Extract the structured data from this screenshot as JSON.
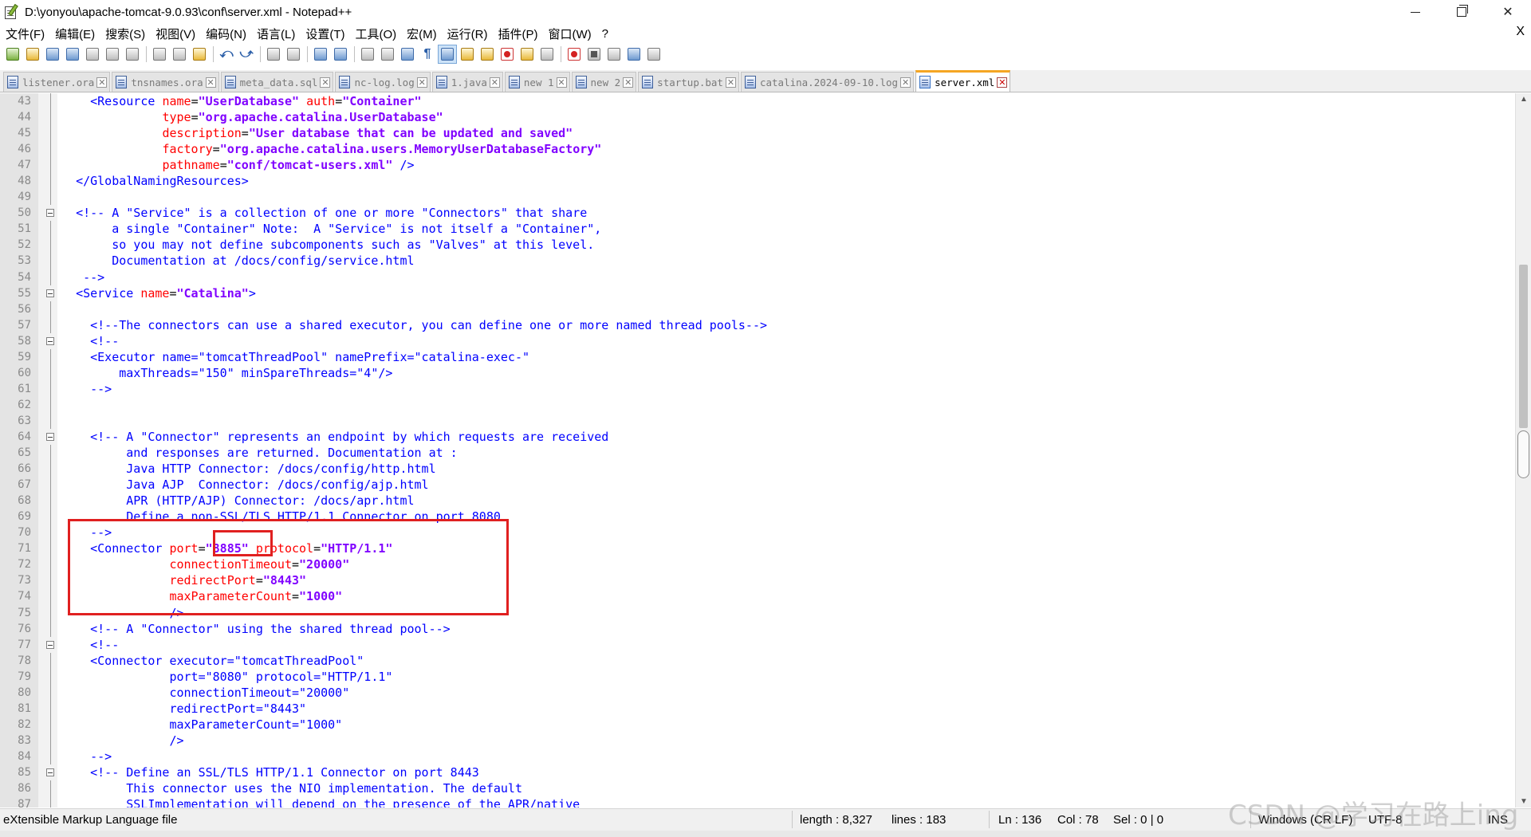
{
  "window": {
    "title": "D:\\yonyou\\apache-tomcat-9.0.93\\conf\\server.xml - Notepad++",
    "minimize": "",
    "restore": "",
    "close": "✕"
  },
  "menu": {
    "items": [
      "文件(F)",
      "编辑(E)",
      "搜索(S)",
      "视图(V)",
      "编码(N)",
      "语言(L)",
      "设置(T)",
      "工具(O)",
      "宏(M)",
      "运行(R)",
      "插件(P)",
      "窗口(W)",
      "?"
    ],
    "close": "X"
  },
  "toolbar": {
    "icons": [
      "new-file-icon",
      "open-file-icon",
      "save-icon",
      "save-all-icon",
      "close-icon",
      "close-all-icon",
      "print-icon",
      "cut-icon",
      "copy-icon",
      "paste-icon",
      "undo-icon",
      "redo-icon",
      "find-icon",
      "replace-icon",
      "zoom-in-icon",
      "zoom-out-icon",
      "sync-vertical-icon",
      "sync-horizontal-icon",
      "word-wrap-icon",
      "show-all-chars-icon",
      "indent-guide-icon",
      "user-language-icon",
      "doc-map-icon",
      "function-list-icon",
      "folder-workspace-icon",
      "monitoring-icon",
      "record-macro-icon",
      "stop-macro-icon",
      "play-macro-icon",
      "run-macro-multiple-icon",
      "save-macro-icon"
    ]
  },
  "tabs": [
    {
      "label": "listener.ora",
      "active": false
    },
    {
      "label": "tnsnames.ora",
      "active": false
    },
    {
      "label": "meta_data.sql",
      "active": false
    },
    {
      "label": "nc-log.log",
      "active": false
    },
    {
      "label": "1.java",
      "active": false
    },
    {
      "label": "new 1",
      "active": false
    },
    {
      "label": "new 2",
      "active": false
    },
    {
      "label": "startup.bat",
      "active": false
    },
    {
      "label": "catalina.2024-09-10.log",
      "active": false
    },
    {
      "label": "server.xml",
      "active": true
    }
  ],
  "editor": {
    "lines": [
      {
        "n": "43",
        "fold": "",
        "segs": [
          [
            "t",
            "    "
          ],
          [
            "tag",
            "<Resource "
          ],
          [
            "attr",
            "name"
          ],
          [
            "t",
            "="
          ],
          [
            "val",
            "\"UserDatabase\""
          ],
          [
            "t",
            " "
          ],
          [
            "attr",
            "auth"
          ],
          [
            "t",
            "="
          ],
          [
            "val",
            "\"Container\""
          ]
        ]
      },
      {
        "n": "44",
        "fold": "",
        "segs": [
          [
            "t",
            "              "
          ],
          [
            "attr",
            "type"
          ],
          [
            "t",
            "="
          ],
          [
            "val",
            "\"org.apache.catalina.UserDatabase\""
          ]
        ]
      },
      {
        "n": "45",
        "fold": "",
        "segs": [
          [
            "t",
            "              "
          ],
          [
            "attr",
            "description"
          ],
          [
            "t",
            "="
          ],
          [
            "val",
            "\"User database that can be updated and saved\""
          ]
        ]
      },
      {
        "n": "46",
        "fold": "",
        "segs": [
          [
            "t",
            "              "
          ],
          [
            "attr",
            "factory"
          ],
          [
            "t",
            "="
          ],
          [
            "val",
            "\"org.apache.catalina.users.MemoryUserDatabaseFactory\""
          ]
        ]
      },
      {
        "n": "47",
        "fold": "",
        "segs": [
          [
            "t",
            "              "
          ],
          [
            "attr",
            "pathname"
          ],
          [
            "t",
            "="
          ],
          [
            "val",
            "\"conf/tomcat-users.xml\""
          ],
          [
            "t",
            " "
          ],
          [
            "tag",
            "/>"
          ]
        ]
      },
      {
        "n": "48",
        "fold": "",
        "segs": [
          [
            "t",
            "  "
          ],
          [
            "tag",
            "</GlobalNamingResources>"
          ]
        ]
      },
      {
        "n": "49",
        "fold": "",
        "segs": []
      },
      {
        "n": "50",
        "fold": "open",
        "segs": [
          [
            "t",
            "  "
          ],
          [
            "tag",
            "<!-- A \"Service\" is a collection of one or more \"Connectors\" that share"
          ]
        ]
      },
      {
        "n": "51",
        "fold": "",
        "segs": [
          [
            "tag",
            "       a single \"Container\" Note:  A \"Service\" is not itself a \"Container\","
          ]
        ]
      },
      {
        "n": "52",
        "fold": "",
        "segs": [
          [
            "tag",
            "       so you may not define subcomponents such as \"Valves\" at this level."
          ]
        ]
      },
      {
        "n": "53",
        "fold": "",
        "segs": [
          [
            "tag",
            "       Documentation at /docs/config/service.html"
          ]
        ]
      },
      {
        "n": "54",
        "fold": "",
        "segs": [
          [
            "tag",
            "   -->"
          ]
        ]
      },
      {
        "n": "55",
        "fold": "open",
        "segs": [
          [
            "t",
            "  "
          ],
          [
            "tag",
            "<Service "
          ],
          [
            "attr",
            "name"
          ],
          [
            "t",
            "="
          ],
          [
            "val",
            "\"Catalina\""
          ],
          [
            "tag",
            ">"
          ]
        ]
      },
      {
        "n": "56",
        "fold": "",
        "segs": []
      },
      {
        "n": "57",
        "fold": "",
        "segs": [
          [
            "t",
            "    "
          ],
          [
            "tag",
            "<!--The connectors can use a shared executor, you can define one or more named thread pools-->"
          ]
        ]
      },
      {
        "n": "58",
        "fold": "open",
        "segs": [
          [
            "t",
            "    "
          ],
          [
            "tag",
            "<!--"
          ]
        ]
      },
      {
        "n": "59",
        "fold": "",
        "segs": [
          [
            "tag",
            "    <Executor name=\"tomcatThreadPool\" namePrefix=\"catalina-exec-\""
          ]
        ]
      },
      {
        "n": "60",
        "fold": "",
        "segs": [
          [
            "tag",
            "        maxThreads=\"150\" minSpareThreads=\"4\"/>"
          ]
        ]
      },
      {
        "n": "61",
        "fold": "",
        "segs": [
          [
            "tag",
            "    -->"
          ]
        ]
      },
      {
        "n": "62",
        "fold": "",
        "segs": []
      },
      {
        "n": "63",
        "fold": "",
        "segs": []
      },
      {
        "n": "64",
        "fold": "open",
        "segs": [
          [
            "t",
            "    "
          ],
          [
            "tag",
            "<!-- A \"Connector\" represents an endpoint by which requests are received"
          ]
        ]
      },
      {
        "n": "65",
        "fold": "",
        "segs": [
          [
            "tag",
            "         and responses are returned. Documentation at :"
          ]
        ]
      },
      {
        "n": "66",
        "fold": "",
        "segs": [
          [
            "tag",
            "         Java HTTP Connector: /docs/config/http.html"
          ]
        ]
      },
      {
        "n": "67",
        "fold": "",
        "segs": [
          [
            "tag",
            "         Java AJP  Connector: /docs/config/ajp.html"
          ]
        ]
      },
      {
        "n": "68",
        "fold": "",
        "segs": [
          [
            "tag",
            "         APR (HTTP/AJP) Connector: /docs/apr.html"
          ]
        ]
      },
      {
        "n": "69",
        "fold": "",
        "segs": [
          [
            "tag",
            "         Define a non-SSL/TLS HTTP/1.1 Connector on port 8080"
          ]
        ]
      },
      {
        "n": "70",
        "fold": "",
        "segs": [
          [
            "tag",
            "    -->"
          ]
        ]
      },
      {
        "n": "71",
        "fold": "",
        "segs": [
          [
            "t",
            "    "
          ],
          [
            "tag",
            "<Connector "
          ],
          [
            "attr",
            "port"
          ],
          [
            "t",
            "="
          ],
          [
            "val",
            "\"8885\""
          ],
          [
            "t",
            " "
          ],
          [
            "attr",
            "protocol"
          ],
          [
            "t",
            "="
          ],
          [
            "val",
            "\"HTTP/1.1\""
          ]
        ]
      },
      {
        "n": "72",
        "fold": "",
        "segs": [
          [
            "t",
            "               "
          ],
          [
            "attr",
            "connectionTimeout"
          ],
          [
            "t",
            "="
          ],
          [
            "val",
            "\"20000\""
          ]
        ]
      },
      {
        "n": "73",
        "fold": "",
        "segs": [
          [
            "t",
            "               "
          ],
          [
            "attr",
            "redirectPort"
          ],
          [
            "t",
            "="
          ],
          [
            "val",
            "\"8443\""
          ]
        ]
      },
      {
        "n": "74",
        "fold": "",
        "segs": [
          [
            "t",
            "               "
          ],
          [
            "attr",
            "maxParameterCount"
          ],
          [
            "t",
            "="
          ],
          [
            "val",
            "\"1000\""
          ]
        ]
      },
      {
        "n": "75",
        "fold": "",
        "segs": [
          [
            "t",
            "               "
          ],
          [
            "tag",
            "/>"
          ]
        ]
      },
      {
        "n": "76",
        "fold": "",
        "segs": [
          [
            "t",
            "    "
          ],
          [
            "tag",
            "<!-- A \"Connector\" using the shared thread pool-->"
          ]
        ]
      },
      {
        "n": "77",
        "fold": "open",
        "segs": [
          [
            "t",
            "    "
          ],
          [
            "tag",
            "<!--"
          ]
        ]
      },
      {
        "n": "78",
        "fold": "",
        "segs": [
          [
            "tag",
            "    <Connector executor=\"tomcatThreadPool\""
          ]
        ]
      },
      {
        "n": "79",
        "fold": "",
        "segs": [
          [
            "tag",
            "               port=\"8080\" protocol=\"HTTP/1.1\""
          ]
        ]
      },
      {
        "n": "80",
        "fold": "",
        "segs": [
          [
            "tag",
            "               connectionTimeout=\"20000\""
          ]
        ]
      },
      {
        "n": "81",
        "fold": "",
        "segs": [
          [
            "tag",
            "               redirectPort=\"8443\""
          ]
        ]
      },
      {
        "n": "82",
        "fold": "",
        "segs": [
          [
            "tag",
            "               maxParameterCount=\"1000\""
          ]
        ]
      },
      {
        "n": "83",
        "fold": "",
        "segs": [
          [
            "tag",
            "               />"
          ]
        ]
      },
      {
        "n": "84",
        "fold": "",
        "segs": [
          [
            "tag",
            "    -->"
          ]
        ]
      },
      {
        "n": "85",
        "fold": "open",
        "segs": [
          [
            "t",
            "    "
          ],
          [
            "tag",
            "<!-- Define an SSL/TLS HTTP/1.1 Connector on port 8443"
          ]
        ]
      },
      {
        "n": "86",
        "fold": "",
        "segs": [
          [
            "tag",
            "         This connector uses the NIO implementation. The default"
          ]
        ]
      },
      {
        "n": "87",
        "fold": "",
        "segs": [
          [
            "tag",
            "         SSLImplementation will depend on the presence of the APR/native"
          ]
        ]
      }
    ]
  },
  "status": {
    "file_type": "eXtensible Markup Language file",
    "length": "length : 8,327",
    "lines": "lines : 183",
    "ln": "Ln : 136",
    "col": "Col : 78",
    "sel": "Sel : 0 | 0",
    "eol": "Windows (CR LF)",
    "encoding": "UTF-8",
    "mode": "INS"
  },
  "watermark": "CSDN @学习在路上ing",
  "colors": {
    "tag": "#0000ff",
    "attribute": "#ff0000",
    "value": "#8000ff",
    "highlight_box": "#e02020",
    "active_tab_accent": "#f5a623"
  }
}
